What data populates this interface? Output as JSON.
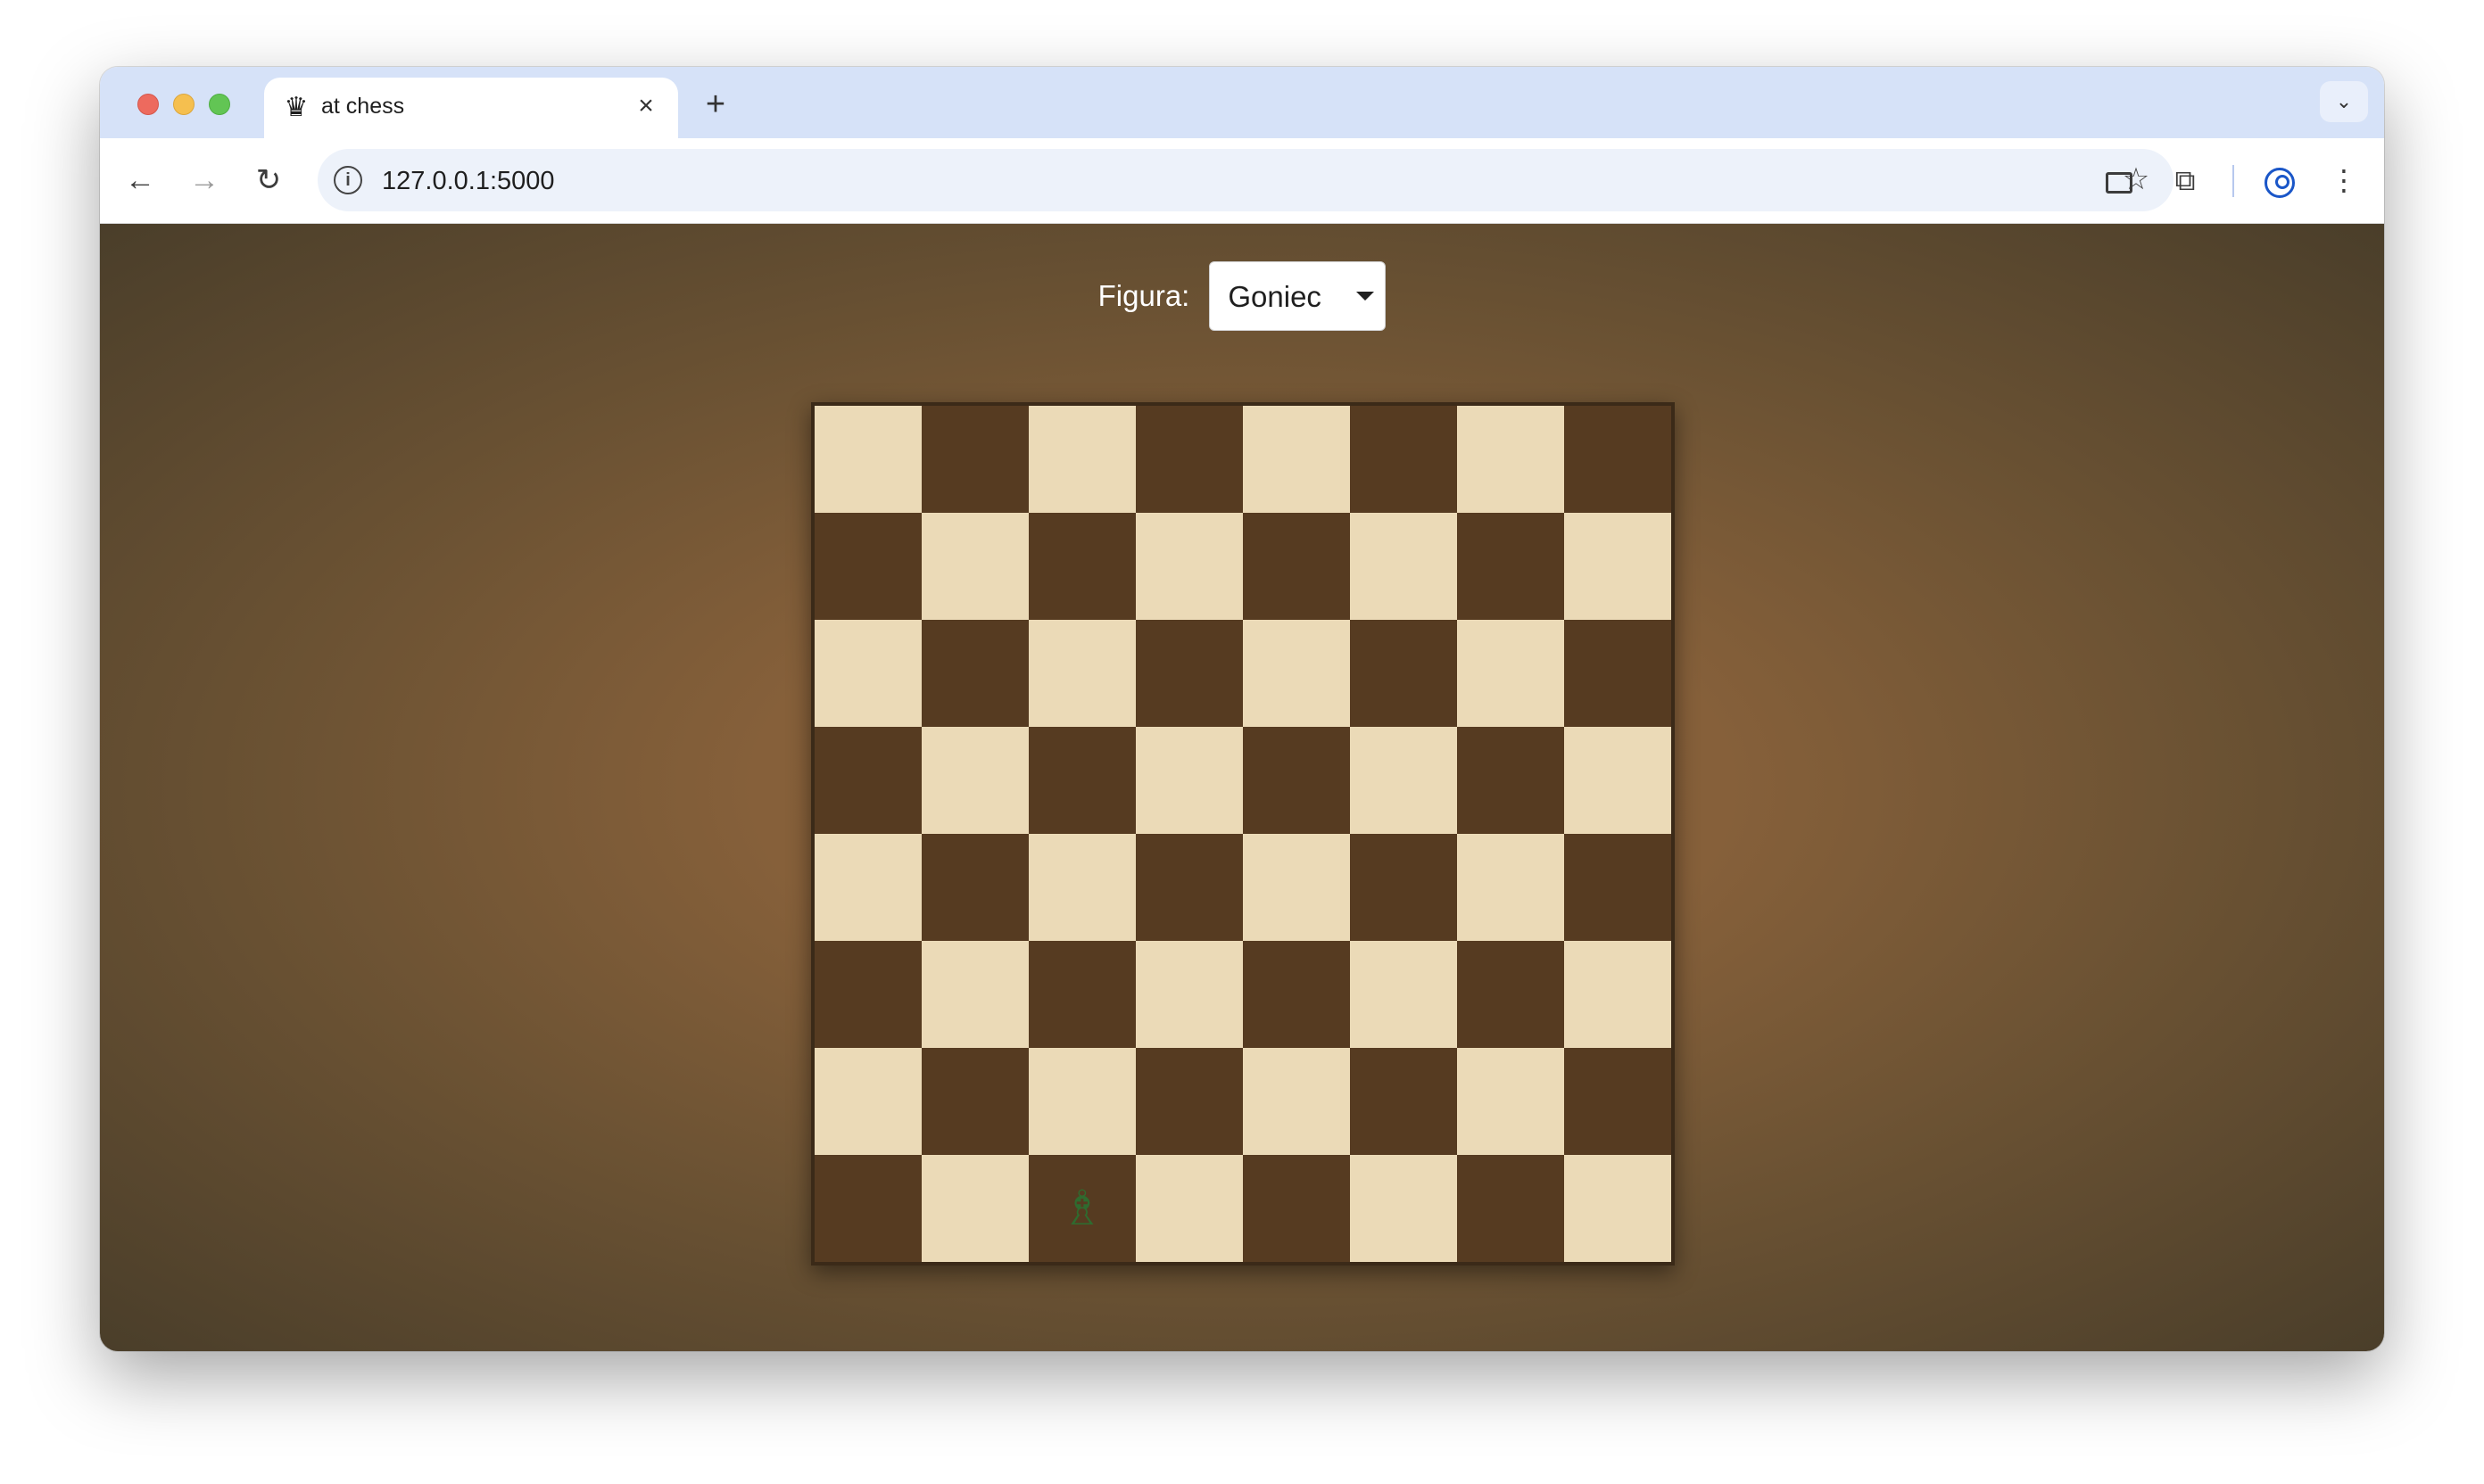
{
  "browser": {
    "tab_title": "at chess",
    "tab_icon": "chess-queen-icon",
    "url": "127.0.0.1:5000"
  },
  "controls": {
    "figure_label": "Figura:",
    "figure_select_value": "Goniec"
  },
  "board": {
    "size": 8,
    "light_color": "#ebdab7",
    "dark_color": "#563b21",
    "pieces": [
      {
        "square": "c1",
        "piece": "bishop",
        "glyph": "♗",
        "color": "#2f6b2f"
      }
    ]
  }
}
